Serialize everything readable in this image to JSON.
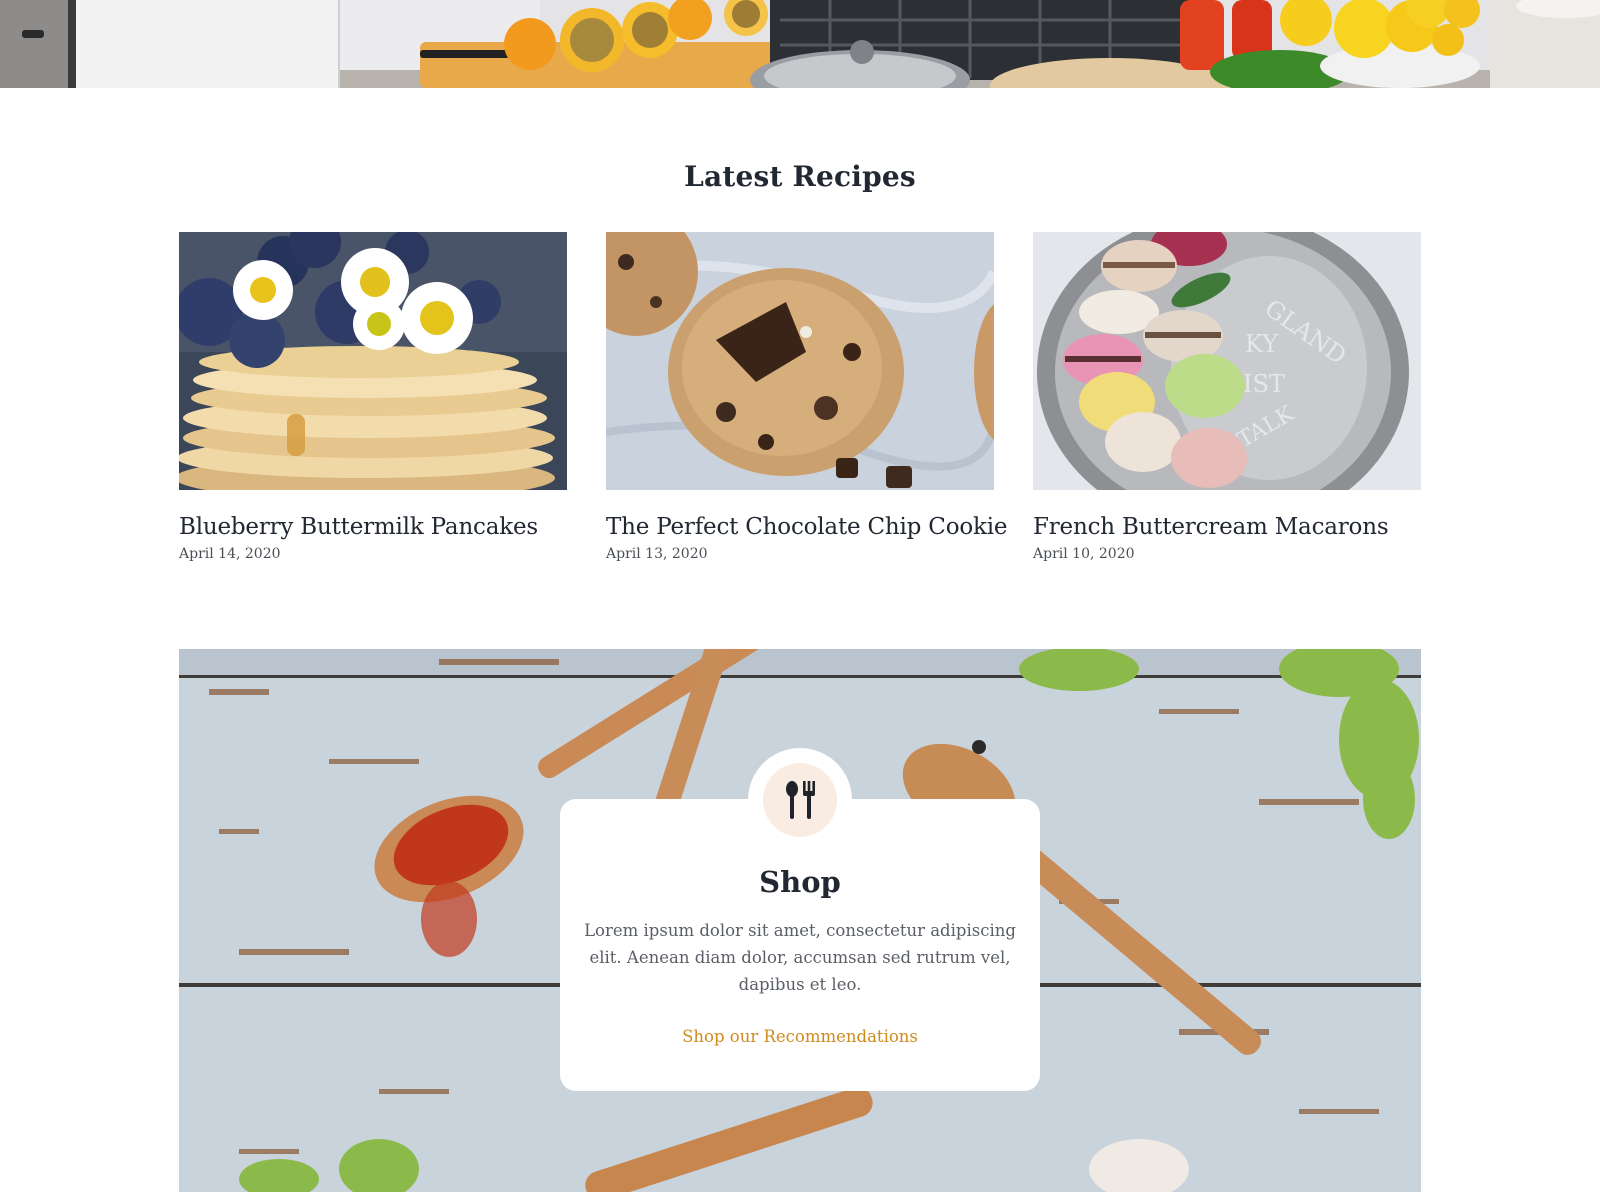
{
  "latest_recipes": {
    "heading": "Latest Recipes",
    "items": [
      {
        "title": "Blueberry Buttermilk Pancakes",
        "date": "April 14, 2020",
        "image": "blueberry-pancakes-photo"
      },
      {
        "title": "The Perfect Chocolate Chip Cookie",
        "date": "April 13, 2020",
        "image": "chocolate-chip-cookie-photo"
      },
      {
        "title": "French Buttercream Macarons",
        "date": "April 10, 2020",
        "image": "macarons-photo"
      }
    ]
  },
  "shop": {
    "icon": "utensils-icon",
    "title": "Shop",
    "description": "Lorem ipsum dolor sit amet, consectetur adipiscing elit. Aenean diam dolor, accumsan sed rutrum vel, dapibus et leo.",
    "link_label": "Shop our Recommendations"
  },
  "colors": {
    "text_dark": "#222831",
    "text_muted": "#5a5f66",
    "link_accent": "#cf8a1e",
    "icon_background": "#f8ece3"
  }
}
